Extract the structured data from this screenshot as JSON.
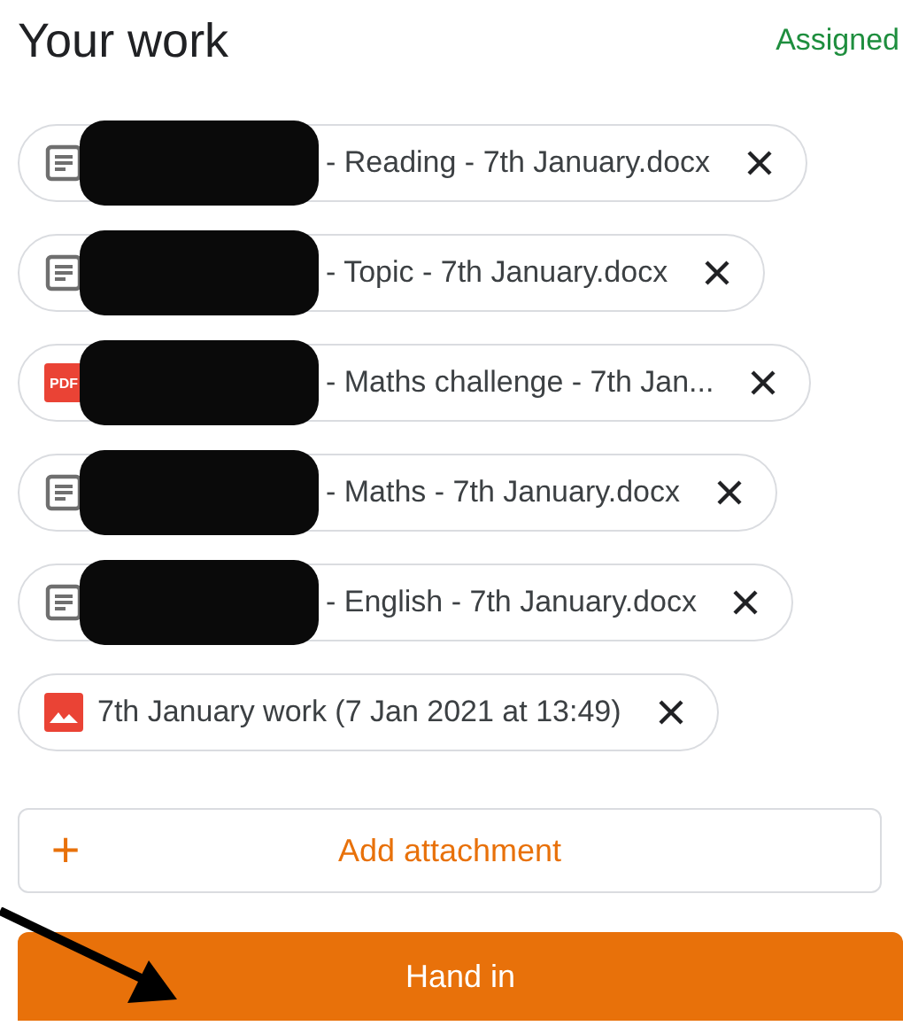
{
  "header": {
    "title": "Your work",
    "status": "Assigned"
  },
  "attachments": [
    {
      "kind": "doc",
      "redacted": true,
      "label": "- Reading - 7th January.docx"
    },
    {
      "kind": "doc",
      "redacted": true,
      "label": "- Topic - 7th January.docx"
    },
    {
      "kind": "pdf",
      "icon_text": "PDF",
      "redacted": true,
      "label": "- Maths challenge - 7th Jan..."
    },
    {
      "kind": "doc",
      "redacted": true,
      "label": "- Maths - 7th January.docx"
    },
    {
      "kind": "doc",
      "redacted": true,
      "label": "- English - 7th January.docx"
    },
    {
      "kind": "image",
      "redacted": false,
      "label": "7th January work (7 Jan 2021 at 13:49)"
    }
  ],
  "add_button": {
    "icon": "+",
    "label": "Add attachment"
  },
  "hand_in_button": {
    "label": "Hand in"
  },
  "annotation": {
    "kind": "arrow"
  }
}
